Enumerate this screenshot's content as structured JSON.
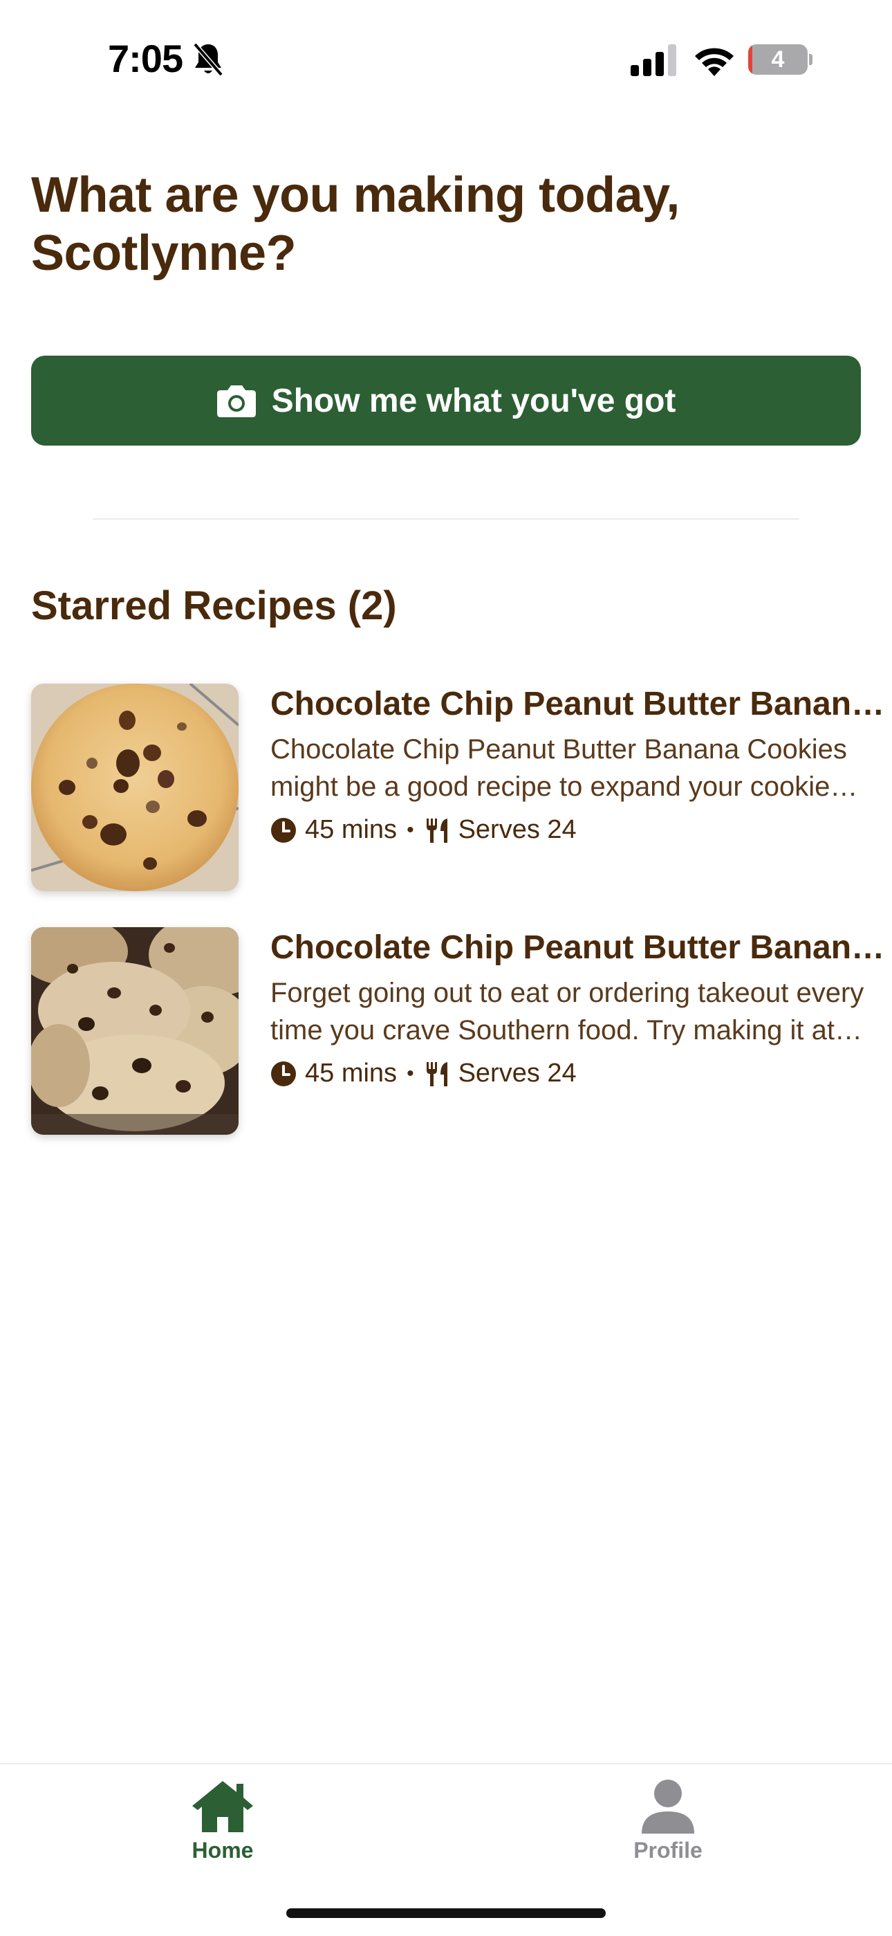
{
  "status_bar": {
    "time": "7:05",
    "battery_level": "4",
    "icons": [
      "bell-slash-icon",
      "cellular-signal-icon",
      "wifi-icon",
      "battery-icon"
    ]
  },
  "greeting": "What are you making today, Scotlynne?",
  "primary_action": {
    "label": "Show me what you've got",
    "icon": "camera-icon",
    "color": "#2c5f34"
  },
  "starred": {
    "title": "Starred Recipes (2)",
    "recipes": [
      {
        "title": "Chocolate Chip Peanut Butter Banana Cookies",
        "description": "Chocolate Chip Peanut Butter Banana Cookies might be a good recipe to expand your cookie repertoire.",
        "time": "45 mins",
        "serves": "Serves 24",
        "image": "chocolate-chip-cookie-photo"
      },
      {
        "title": "Chocolate Chip Peanut Butter Banana Cookies",
        "description": "Forget going out to eat or ordering takeout every time you crave Southern food. Try making it at home.",
        "time": "45 mins",
        "serves": "Serves 24",
        "image": "stacked-cookies-photo"
      }
    ]
  },
  "meta_separator": "•",
  "tab_bar": {
    "tabs": [
      {
        "label": "Home",
        "icon": "home-icon",
        "active": true
      },
      {
        "label": "Profile",
        "icon": "profile-icon",
        "active": false
      }
    ],
    "active_color": "#2c5f34",
    "inactive_color": "#8e8e93"
  },
  "colors": {
    "text_brown": "#4a2a0c",
    "accent_green": "#2c5f34"
  }
}
